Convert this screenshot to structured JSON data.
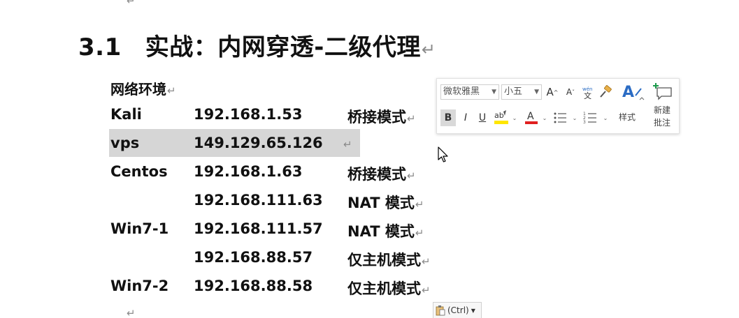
{
  "return_glyph": "↵",
  "heading": {
    "number": "3.1",
    "title": "实战：内网穿透-二级代理"
  },
  "section_label": "网络环境",
  "rows": [
    {
      "host": "Kali",
      "ip": "192.168.1.53",
      "mode": "桥接模式"
    },
    {
      "host": "vps",
      "ip": "149.129.65.126",
      "mode": ""
    },
    {
      "host": "Centos",
      "ip": "192.168.1.63",
      "mode": "桥接模式"
    },
    {
      "host": "",
      "ip": "192.168.111.63",
      "mode": "NAT 模式"
    },
    {
      "host": "Win7-1",
      "ip": "192.168.111.57",
      "mode": "NAT 模式"
    },
    {
      "host": "",
      "ip": "192.168.88.57",
      "mode": "仅主机模式"
    },
    {
      "host": "Win7-2",
      "ip": "192.168.88.58",
      "mode": "仅主机模式"
    }
  ],
  "mini_toolbar": {
    "font_name": "微软雅黑",
    "font_size": "小五",
    "grow_font_glyph": "A",
    "shrink_font_glyph": "A",
    "bold": "B",
    "italic": "I",
    "underline": "U",
    "styles_label": "样式",
    "new_comment_line1": "新建",
    "new_comment_line2": "批注",
    "highlight_color": "#ffe600",
    "font_color": "#e02020"
  },
  "paste_options": {
    "label": "(Ctrl)"
  }
}
